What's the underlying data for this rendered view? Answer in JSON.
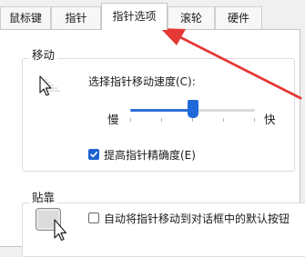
{
  "tabs": [
    {
      "label": "鼠标键",
      "active": false
    },
    {
      "label": "指针",
      "active": false
    },
    {
      "label": "指针选项",
      "active": true
    },
    {
      "label": "滚轮",
      "active": false
    },
    {
      "label": "硬件",
      "active": false
    }
  ],
  "motion": {
    "legend": "移动",
    "speed_label": "选择指针移动速度(C):",
    "slow_label": "慢",
    "fast_label": "快",
    "speed_fraction": 0.5,
    "precision_label": "提高指针精确度(E)",
    "precision_checked": true
  },
  "snap": {
    "legend": "贴靠",
    "autosnap_label": "自动将指针移动到对话框中的默认按钮",
    "autosnap_checked": false
  },
  "colors": {
    "accent": "#1f6ad8",
    "annotation_arrow": "#e53935"
  }
}
